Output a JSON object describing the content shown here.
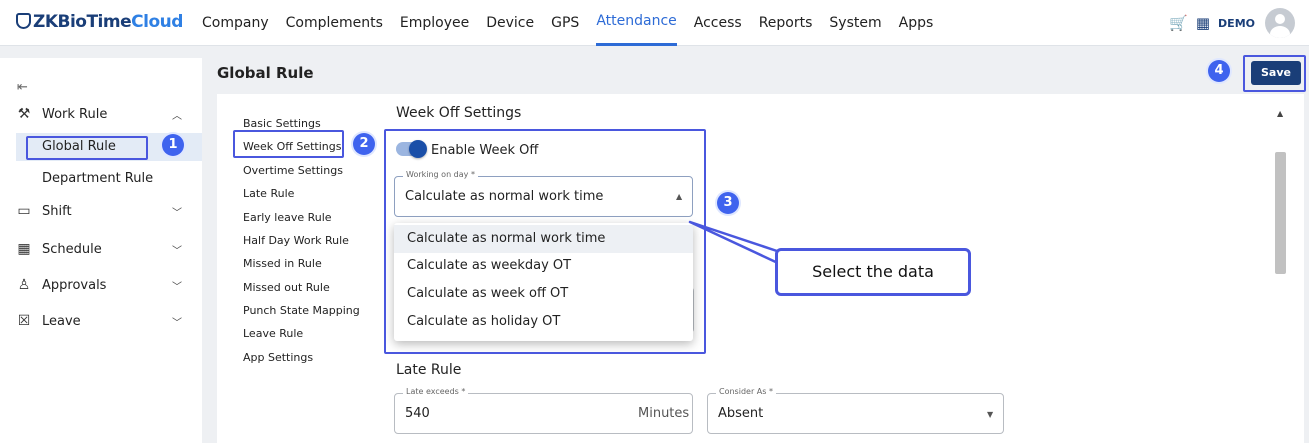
{
  "app": {
    "logo_brand": "ZKBioTime",
    "logo_suffix": "Cloud",
    "nav": [
      "Company",
      "Complements",
      "Employee",
      "Device",
      "GPS",
      "Attendance",
      "Access",
      "Reports",
      "System",
      "Apps"
    ],
    "active_nav": "Attendance",
    "user": "DEMO"
  },
  "sidebar": {
    "groups": [
      {
        "label": "Work Rule",
        "icon": "gavel-icon",
        "expanded": true,
        "children": [
          "Global Rule",
          "Department Rule"
        ]
      },
      {
        "label": "Shift",
        "icon": "calendar-icon",
        "expanded": false
      },
      {
        "label": "Schedule",
        "icon": "calendar-grid-icon",
        "expanded": false
      },
      {
        "label": "Approvals",
        "icon": "approvals-icon",
        "expanded": false
      },
      {
        "label": "Leave",
        "icon": "leave-calendar-icon",
        "expanded": false
      }
    ],
    "selected": "Global Rule"
  },
  "page": {
    "title": "Global Rule",
    "save_label": "Save"
  },
  "settings_nav": [
    "Basic Settings",
    "Week Off Settings",
    "Overtime Settings",
    "Late Rule",
    "Early leave Rule",
    "Half Day Work Rule",
    "Missed in Rule",
    "Missed out Rule",
    "Punch State Mapping",
    "Leave Rule",
    "App Settings"
  ],
  "week_off": {
    "heading": "Week Off Settings",
    "toggle_label": "Enable Week Off",
    "toggle_on": true,
    "working_label": "Working on day *",
    "working_value": "Calculate as normal work time",
    "options": [
      "Calculate as normal work time",
      "Calculate as weekday OT",
      "Calculate as week off OT",
      "Calculate as holiday OT"
    ]
  },
  "late_rule": {
    "heading": "Late Rule",
    "late_exceeds_label": "Late exceeds *",
    "late_exceeds_value": "540",
    "late_exceeds_unit": "Minutes",
    "consider_label": "Consider As *",
    "consider_value": "Absent"
  },
  "annotations": {
    "steps": [
      "1",
      "2",
      "3",
      "4"
    ],
    "callout": "Select the data",
    "color": "#4a57de"
  }
}
